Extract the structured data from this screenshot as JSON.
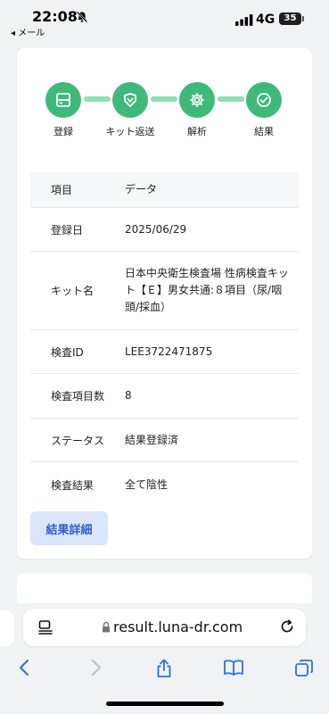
{
  "status_bar": {
    "time": "22:08",
    "back_app": "◂ メール",
    "network": "4G",
    "battery": "35"
  },
  "stepper": {
    "steps": [
      {
        "label": "登録",
        "icon": "register-icon"
      },
      {
        "label": "キット返送",
        "icon": "kit-return-icon"
      },
      {
        "label": "解析",
        "icon": "gear-icon"
      },
      {
        "label": "結果",
        "icon": "check-icon"
      }
    ],
    "active_color": "#3fb97a",
    "connector_color": "#8ee0b3"
  },
  "table": {
    "headers": [
      "項目",
      "データ"
    ],
    "rows": [
      {
        "label": "登録日",
        "value": "2025/06/29"
      },
      {
        "label": "キット名",
        "value": "日本中央衛生検査場 性病検査キット【Ｅ】男女共通:８項目（尿/咽頭/採血）"
      },
      {
        "label": "検査ID",
        "value": "LEE3722471875"
      },
      {
        "label": "検査項目数",
        "value": "8"
      },
      {
        "label": "ステータス",
        "value": "結果登録済"
      },
      {
        "label": "検査結果",
        "value": "全て陰性"
      }
    ]
  },
  "detail_button": "結果詳細",
  "browser": {
    "url": "result.luna-dr.com"
  }
}
